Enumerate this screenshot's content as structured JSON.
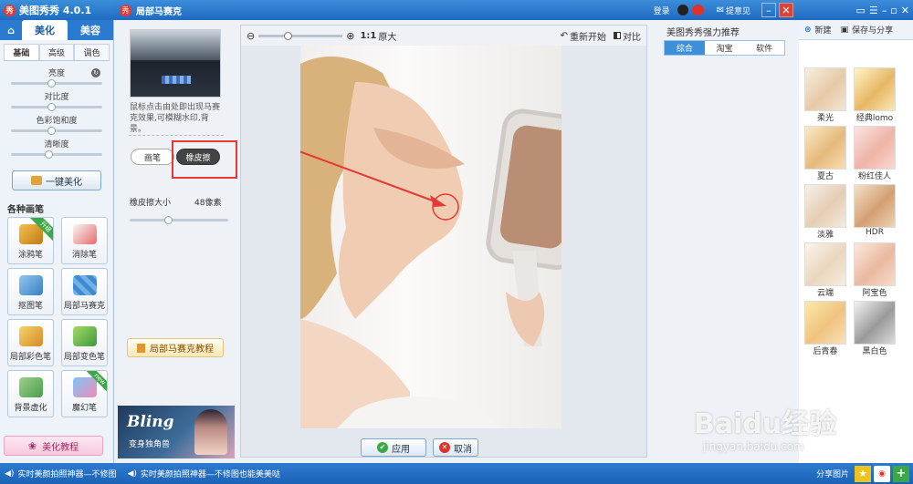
{
  "app": {
    "title": "美图秀秀 4.0.1",
    "logo_text": "秀"
  },
  "left": {
    "main_tabs": [
      "美化",
      "美容"
    ],
    "sub_tabs": [
      "基础",
      "高级",
      "调色"
    ],
    "sliders": [
      {
        "label": "亮度",
        "value": 0.5
      },
      {
        "label": "对比度",
        "value": 0.5
      },
      {
        "label": "色彩饱和度",
        "value": 0.5
      },
      {
        "label": "清晰度",
        "value": 0.45
      }
    ],
    "one_click": "一键美化",
    "brush_section": "各种画笔",
    "tools": [
      {
        "label": "涂鸦笔",
        "badge": "升级"
      },
      {
        "label": "消除笔",
        "badge": ""
      },
      {
        "label": "抠图笔",
        "badge": ""
      },
      {
        "label": "局部马赛克",
        "badge": ""
      },
      {
        "label": "局部彩色笔",
        "badge": ""
      },
      {
        "label": "局部变色笔",
        "badge": ""
      },
      {
        "label": "背景虚化",
        "badge": ""
      },
      {
        "label": "魔幻笔",
        "badge": "new"
      }
    ],
    "tutorial": "美化教程"
  },
  "dialog": {
    "title": "局部马赛克",
    "login": "登录",
    "feedback": "提意见",
    "desc": "鼠标点击由处即出现马赛克效果,可模糊水印,背景。",
    "modes": [
      "画笔",
      "橡皮擦"
    ],
    "eraser_size_label": "橡皮擦大小",
    "eraser_size_value": "48像素",
    "eraser_size_level": 0.35,
    "tutorial": "局部马赛克教程",
    "ad_title": "Bling",
    "ad_sub": "变身独角兽",
    "zoom_level": 0.3,
    "zoom_label": "1:1",
    "original": "原大",
    "restart": "重新开始",
    "compare": "对比",
    "apply": "应用",
    "cancel": "取消",
    "recommend_title": "美图秀秀强力推荐",
    "recommend_tabs": [
      "综合",
      "淘宝",
      "软件"
    ]
  },
  "right": {
    "new": "新建",
    "save_share": "保存与分享",
    "effects": [
      "柔光",
      "经典lomo",
      "夏古",
      "粉红佳人",
      "淡雅",
      "HDR",
      "云端",
      "阿宝色",
      "后青春",
      "黑白色"
    ],
    "share": "分享图片"
  },
  "status": {
    "text": "实时美颜拍照神器—不修图也能美美哒",
    "text_short": "实时美颜拍照神器—不修图"
  },
  "watermark": {
    "logo": "Baidu经验",
    "url": "jingyan.baidu.com"
  },
  "colors": {
    "accent": "#2a7bd0",
    "highlight": "#e53935",
    "primary_tab": "#3c8fd9"
  }
}
